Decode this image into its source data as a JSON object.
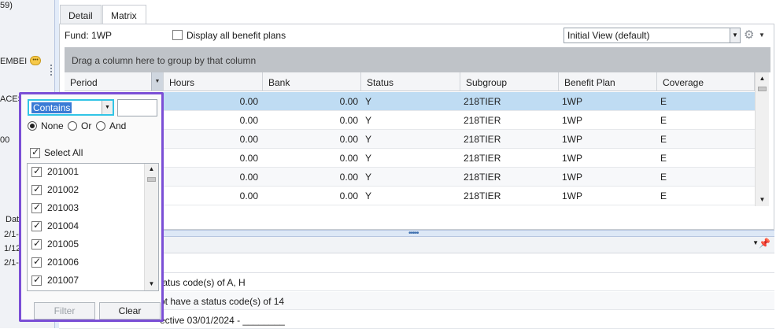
{
  "left_panel": {
    "frag1": "59)",
    "frag2": "EMBEI",
    "frag3": "ACES",
    "frag4": "00",
    "frag5": "Dat",
    "frag6": "2/1‐",
    "frag7": "1/12",
    "frag8": "2/1‐"
  },
  "tabs": [
    {
      "label": "Detail"
    },
    {
      "label": "Matrix"
    }
  ],
  "fund": {
    "label": "Fund: 1WP"
  },
  "display_all": {
    "label": "Display all benefit plans",
    "checked": false
  },
  "view_select": {
    "value": "Initial View (default)"
  },
  "group_bar": {
    "text": "Drag a column here to group by that column"
  },
  "columns": [
    "Period",
    "Hours",
    "Bank",
    "Status",
    "Subgroup",
    "Benefit Plan",
    "Coverage"
  ],
  "rows": [
    {
      "hours": "0.00",
      "bank": "0.00",
      "status": "Y",
      "subgroup": "218TIER",
      "plan": "1WP",
      "coverage": "E"
    },
    {
      "hours": "0.00",
      "bank": "0.00",
      "status": "Y",
      "subgroup": "218TIER",
      "plan": "1WP",
      "coverage": "E"
    },
    {
      "hours": "0.00",
      "bank": "0.00",
      "status": "Y",
      "subgroup": "218TIER",
      "plan": "1WP",
      "coverage": "E"
    },
    {
      "hours": "0.00",
      "bank": "0.00",
      "status": "Y",
      "subgroup": "218TIER",
      "plan": "1WP",
      "coverage": "E"
    },
    {
      "hours": "0.00",
      "bank": "0.00",
      "status": "Y",
      "subgroup": "218TIER",
      "plan": "1WP",
      "coverage": "E"
    },
    {
      "hours": "0.00",
      "bank": "0.00",
      "status": "Y",
      "subgroup": "218TIER",
      "plan": "1WP",
      "coverage": "E"
    }
  ],
  "messages": [
    "tatus code(s) of A, H",
    "ot have a status code(s) of 14",
    "ective 03/01/2024 - ________"
  ],
  "filter_popup": {
    "operator": "Contains",
    "value": "",
    "radio_none": "None",
    "radio_or": "Or",
    "radio_and": "And",
    "select_all": "Select All",
    "items": [
      "201001",
      "201002",
      "201003",
      "201004",
      "201005",
      "201006",
      "201007"
    ],
    "filter_button": "Filter",
    "clear_button": "Clear"
  },
  "colors": {
    "popup_border": "#7b4fd6",
    "selected_row": "#bfdcf3",
    "group_bar": "#bfc3c8"
  }
}
